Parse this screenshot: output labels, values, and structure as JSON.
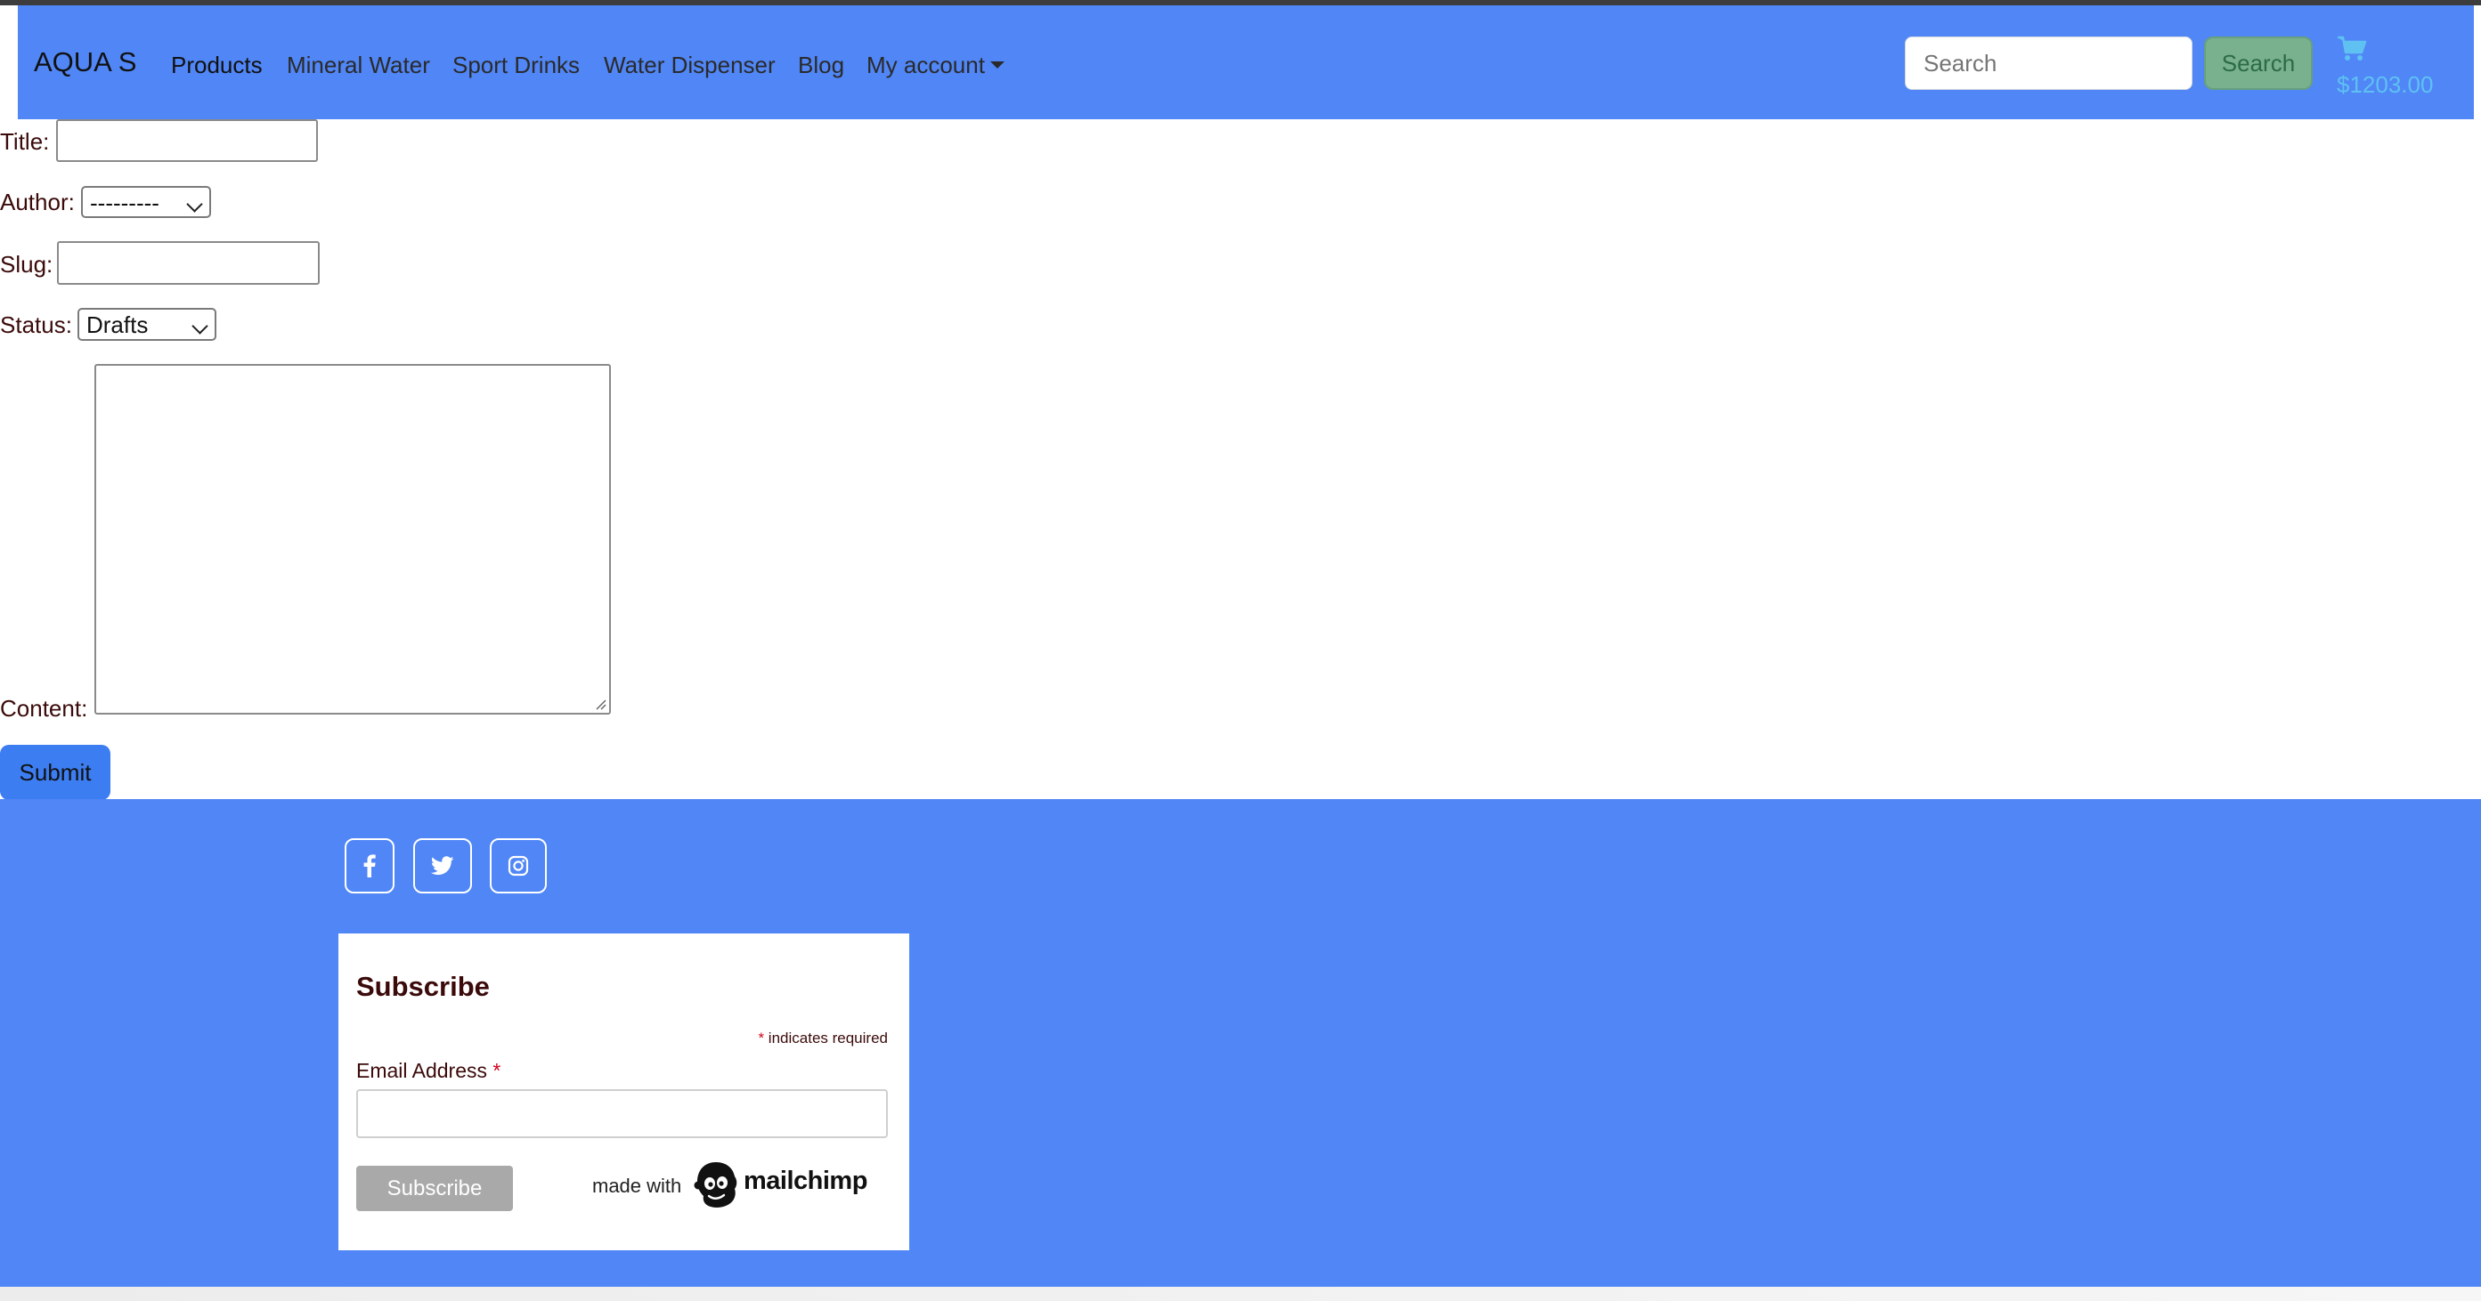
{
  "navbar": {
    "brand": "AQUA S",
    "items": [
      {
        "label": "Products",
        "active": true
      },
      {
        "label": "Mineral Water"
      },
      {
        "label": "Sport Drinks"
      },
      {
        "label": "Water Dispenser"
      },
      {
        "label": "Blog"
      },
      {
        "label": "My account",
        "dropdown": true
      }
    ],
    "search": {
      "placeholder": "Search",
      "button_label": "Search"
    },
    "cart": {
      "icon": "cart-icon",
      "total": "$1203.00"
    }
  },
  "form": {
    "title_label": "Title:",
    "title_value": "",
    "author_label": "Author:",
    "author_selected": "---------",
    "slug_label": "Slug:",
    "slug_value": "",
    "status_label": "Status:",
    "status_selected": "Drafts",
    "content_label": "Content:",
    "content_value": "",
    "submit_label": "Submit"
  },
  "footer": {
    "social": [
      {
        "icon": "facebook-icon"
      },
      {
        "icon": "twitter-icon"
      },
      {
        "icon": "instagram-icon"
      }
    ],
    "subscribe": {
      "title": "Subscribe",
      "required_star": "*",
      "required_note": "indicates required",
      "email_label": "Email Address",
      "email_value": "",
      "button_label": "Subscribe",
      "made_with": "made with",
      "brand": "mailchimp"
    }
  },
  "colors": {
    "navbar_bg": "#5086f6",
    "footer_bg": "#5086f6",
    "submit_bg": "#3c7df2",
    "search_btn_bg": "#79b08e",
    "cart_color": "#5ec1f2",
    "label_text": "#3b0a0a"
  }
}
